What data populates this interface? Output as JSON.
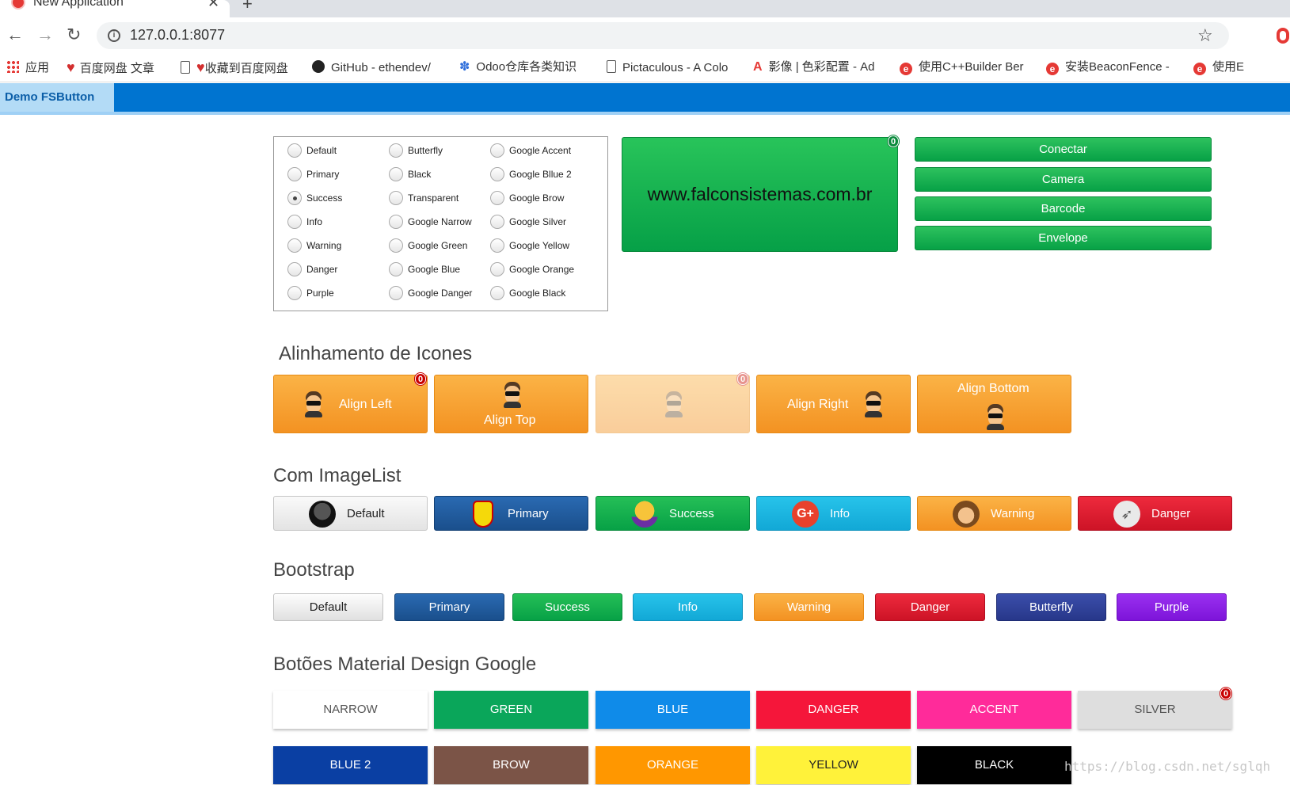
{
  "browser": {
    "tab_title": "New Application",
    "url": "127.0.0.1:8077",
    "bookmarks": [
      "应用",
      "百度网盘 文章",
      "收藏到百度网盘",
      "GitHub - ethendev/",
      "Odoo仓库各类知识",
      "Pictaculous - A Colo",
      "影像 | 色彩配置 - Ad",
      "使用C++Builder Ber",
      "安装BeaconFence -",
      "使用E"
    ]
  },
  "app": {
    "tab_label": "Demo FSButton"
  },
  "radios": {
    "col1": [
      "Default",
      "Primary",
      "Success",
      "Info",
      "Warning",
      "Danger",
      "Purple"
    ],
    "col2": [
      "Butterfly",
      "Black",
      "Transparent",
      "Google Narrow",
      "Google Green",
      "Google Blue",
      "Google Danger"
    ],
    "col3": [
      "Google Accent",
      "Google Bllue 2",
      "Google Brow",
      "Google Silver",
      "Google Yellow",
      "Google Orange",
      "Google Black"
    ],
    "selected": "Success"
  },
  "big_button": {
    "label": "www.falconsistemas.com.br",
    "badge": "0"
  },
  "stack_buttons": [
    "Conectar",
    "Camera",
    "Barcode",
    "Envelope"
  ],
  "align_section": {
    "title": "Alinhamento de Icones",
    "buttons": [
      "Align Left",
      "Align Top",
      "",
      "Align Right",
      "Align Bottom"
    ],
    "badge": "0"
  },
  "imagelist_section": {
    "title": "Com ImageList",
    "buttons": [
      "Default",
      "Primary",
      "Success",
      "Info",
      "Warning",
      "Danger"
    ]
  },
  "bootstrap_section": {
    "title": "Bootstrap",
    "buttons": [
      "Default",
      "Primary",
      "Success",
      "Info",
      "Warning",
      "Danger",
      "Butterfly",
      "Purple"
    ]
  },
  "material_section": {
    "title": "Botões Material Design Google",
    "row1": [
      "NARROW",
      "GREEN",
      "BLUE",
      "DANGER",
      "ACCENT",
      "SILVER"
    ],
    "row2": [
      "BLUE 2",
      "BROW",
      "ORANGE",
      "YELLOW",
      "BLACK"
    ],
    "badge": "0"
  },
  "colors": {
    "app_header": "#0074d0",
    "success": "#07a146",
    "warning": "#f39222",
    "primary": "#1f5ea6",
    "info": "#1ab4e0",
    "danger": "#e0162b",
    "butterfly": "#2e3e9a",
    "purple": "#8a1fe6"
  },
  "watermark": "https://blog.csdn.net/sglqh"
}
